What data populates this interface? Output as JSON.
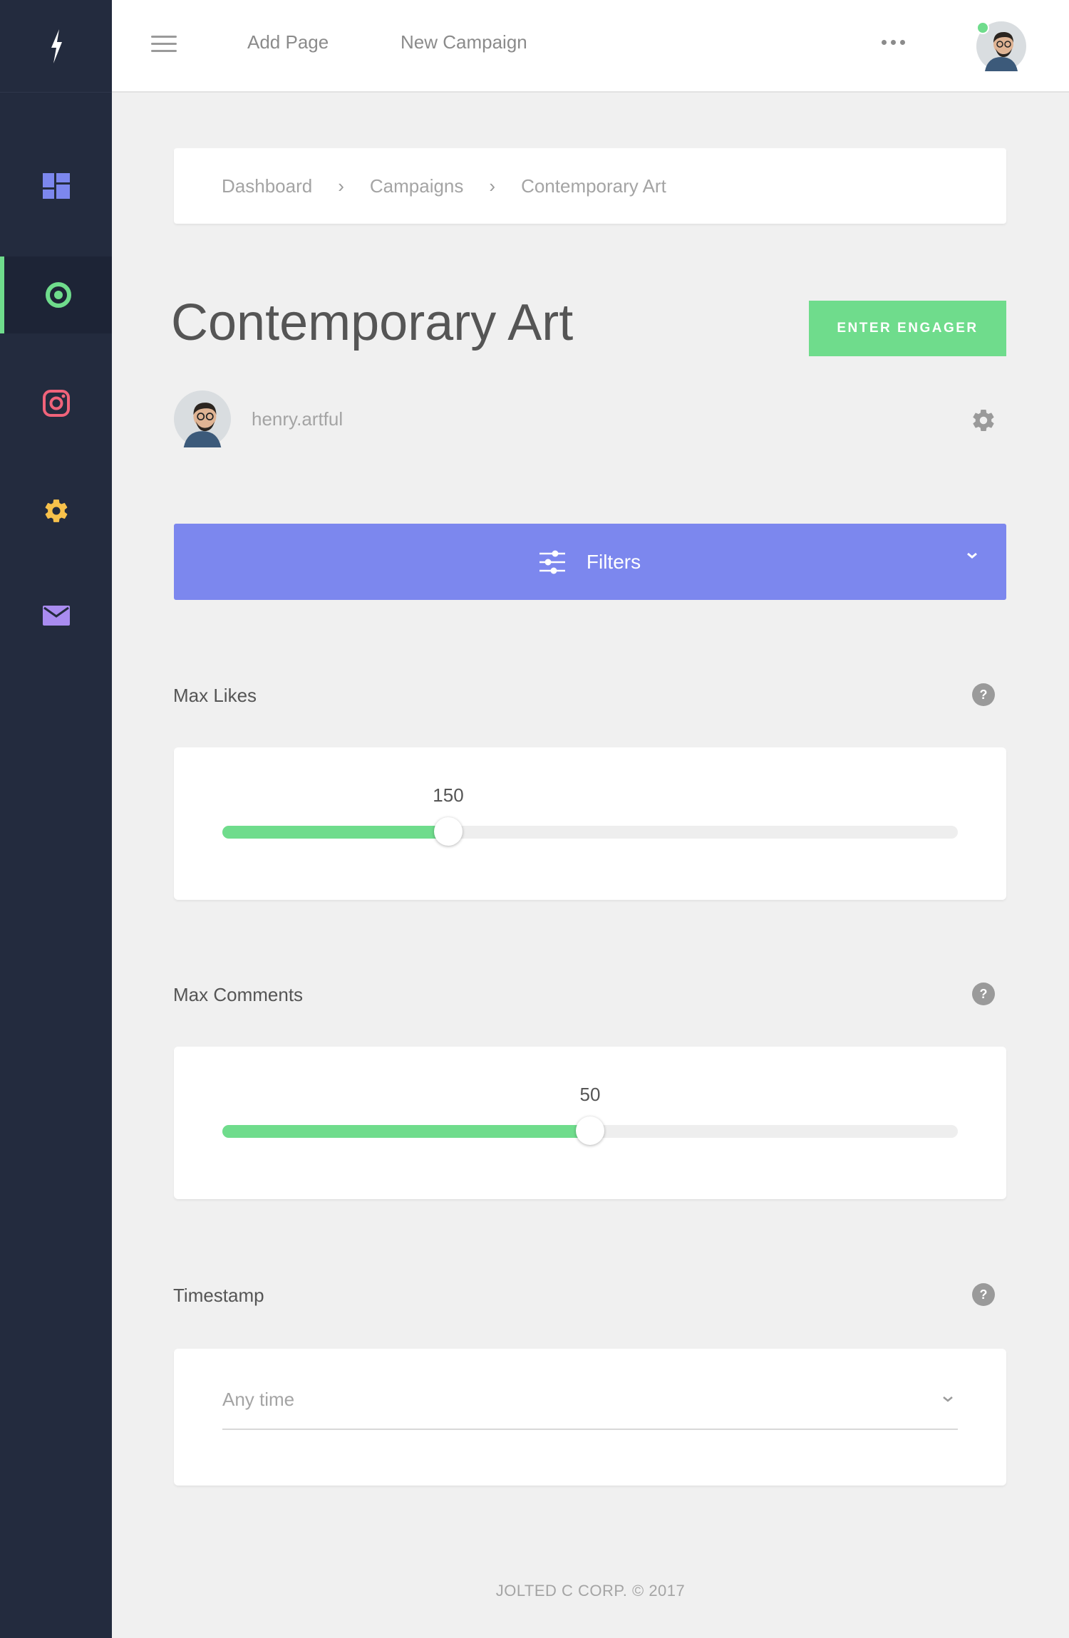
{
  "topbar": {
    "menu_icon": "hamburger-icon",
    "links": [
      "Add Page",
      "New Campaign"
    ],
    "more_icon": "more-dots-icon",
    "avatar_status_color": "#6fdc8c"
  },
  "sidebar": {
    "logo_icon": "bolt-icon",
    "items": [
      {
        "icon": "dashboard-icon",
        "color": "#7c87ee",
        "active": false
      },
      {
        "icon": "target-icon",
        "color": "#6fdc8c",
        "active": true
      },
      {
        "icon": "instagram-icon",
        "color": "#f0637a",
        "active": false
      },
      {
        "icon": "gear-icon",
        "color": "#f7c14b",
        "active": false
      },
      {
        "icon": "mail-icon",
        "color": "#a98cf0",
        "active": false
      }
    ]
  },
  "breadcrumb": [
    "Dashboard",
    "Campaigns",
    "Contemporary Art"
  ],
  "page": {
    "title": "Contemporary Art",
    "enter_button": "ENTER ENGAGER",
    "username": "henry.artful"
  },
  "filters": {
    "label": "Filters"
  },
  "max_likes": {
    "label": "Max Likes",
    "value": "150",
    "fill_fraction": 0.307
  },
  "max_comments": {
    "label": "Max Comments",
    "value": "50",
    "fill_fraction": 0.5
  },
  "timestamp": {
    "label": "Timestamp",
    "selected": "Any time"
  },
  "help_glyph": "?",
  "footer": "JOLTED C CORP. © 2017",
  "colors": {
    "accent_green": "#6fdc8c",
    "filters_blue": "#7c87ee",
    "sidebar_bg": "#232b3e"
  }
}
